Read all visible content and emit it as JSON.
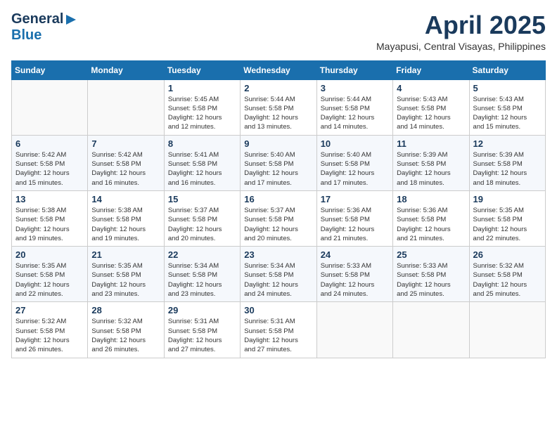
{
  "header": {
    "logo": {
      "general": "General",
      "blue": "Blue",
      "triangle": "▶"
    },
    "month": "April 2025",
    "location": "Mayapusi, Central Visayas, Philippines"
  },
  "weekdays": [
    "Sunday",
    "Monday",
    "Tuesday",
    "Wednesday",
    "Thursday",
    "Friday",
    "Saturday"
  ],
  "weeks": [
    [
      {
        "day": "",
        "info": ""
      },
      {
        "day": "",
        "info": ""
      },
      {
        "day": "1",
        "info": "Sunrise: 5:45 AM\nSunset: 5:58 PM\nDaylight: 12 hours\nand 12 minutes."
      },
      {
        "day": "2",
        "info": "Sunrise: 5:44 AM\nSunset: 5:58 PM\nDaylight: 12 hours\nand 13 minutes."
      },
      {
        "day": "3",
        "info": "Sunrise: 5:44 AM\nSunset: 5:58 PM\nDaylight: 12 hours\nand 14 minutes."
      },
      {
        "day": "4",
        "info": "Sunrise: 5:43 AM\nSunset: 5:58 PM\nDaylight: 12 hours\nand 14 minutes."
      },
      {
        "day": "5",
        "info": "Sunrise: 5:43 AM\nSunset: 5:58 PM\nDaylight: 12 hours\nand 15 minutes."
      }
    ],
    [
      {
        "day": "6",
        "info": "Sunrise: 5:42 AM\nSunset: 5:58 PM\nDaylight: 12 hours\nand 15 minutes."
      },
      {
        "day": "7",
        "info": "Sunrise: 5:42 AM\nSunset: 5:58 PM\nDaylight: 12 hours\nand 16 minutes."
      },
      {
        "day": "8",
        "info": "Sunrise: 5:41 AM\nSunset: 5:58 PM\nDaylight: 12 hours\nand 16 minutes."
      },
      {
        "day": "9",
        "info": "Sunrise: 5:40 AM\nSunset: 5:58 PM\nDaylight: 12 hours\nand 17 minutes."
      },
      {
        "day": "10",
        "info": "Sunrise: 5:40 AM\nSunset: 5:58 PM\nDaylight: 12 hours\nand 17 minutes."
      },
      {
        "day": "11",
        "info": "Sunrise: 5:39 AM\nSunset: 5:58 PM\nDaylight: 12 hours\nand 18 minutes."
      },
      {
        "day": "12",
        "info": "Sunrise: 5:39 AM\nSunset: 5:58 PM\nDaylight: 12 hours\nand 18 minutes."
      }
    ],
    [
      {
        "day": "13",
        "info": "Sunrise: 5:38 AM\nSunset: 5:58 PM\nDaylight: 12 hours\nand 19 minutes."
      },
      {
        "day": "14",
        "info": "Sunrise: 5:38 AM\nSunset: 5:58 PM\nDaylight: 12 hours\nand 19 minutes."
      },
      {
        "day": "15",
        "info": "Sunrise: 5:37 AM\nSunset: 5:58 PM\nDaylight: 12 hours\nand 20 minutes."
      },
      {
        "day": "16",
        "info": "Sunrise: 5:37 AM\nSunset: 5:58 PM\nDaylight: 12 hours\nand 20 minutes."
      },
      {
        "day": "17",
        "info": "Sunrise: 5:36 AM\nSunset: 5:58 PM\nDaylight: 12 hours\nand 21 minutes."
      },
      {
        "day": "18",
        "info": "Sunrise: 5:36 AM\nSunset: 5:58 PM\nDaylight: 12 hours\nand 21 minutes."
      },
      {
        "day": "19",
        "info": "Sunrise: 5:35 AM\nSunset: 5:58 PM\nDaylight: 12 hours\nand 22 minutes."
      }
    ],
    [
      {
        "day": "20",
        "info": "Sunrise: 5:35 AM\nSunset: 5:58 PM\nDaylight: 12 hours\nand 22 minutes."
      },
      {
        "day": "21",
        "info": "Sunrise: 5:35 AM\nSunset: 5:58 PM\nDaylight: 12 hours\nand 23 minutes."
      },
      {
        "day": "22",
        "info": "Sunrise: 5:34 AM\nSunset: 5:58 PM\nDaylight: 12 hours\nand 23 minutes."
      },
      {
        "day": "23",
        "info": "Sunrise: 5:34 AM\nSunset: 5:58 PM\nDaylight: 12 hours\nand 24 minutes."
      },
      {
        "day": "24",
        "info": "Sunrise: 5:33 AM\nSunset: 5:58 PM\nDaylight: 12 hours\nand 24 minutes."
      },
      {
        "day": "25",
        "info": "Sunrise: 5:33 AM\nSunset: 5:58 PM\nDaylight: 12 hours\nand 25 minutes."
      },
      {
        "day": "26",
        "info": "Sunrise: 5:32 AM\nSunset: 5:58 PM\nDaylight: 12 hours\nand 25 minutes."
      }
    ],
    [
      {
        "day": "27",
        "info": "Sunrise: 5:32 AM\nSunset: 5:58 PM\nDaylight: 12 hours\nand 26 minutes."
      },
      {
        "day": "28",
        "info": "Sunrise: 5:32 AM\nSunset: 5:58 PM\nDaylight: 12 hours\nand 26 minutes."
      },
      {
        "day": "29",
        "info": "Sunrise: 5:31 AM\nSunset: 5:58 PM\nDaylight: 12 hours\nand 27 minutes."
      },
      {
        "day": "30",
        "info": "Sunrise: 5:31 AM\nSunset: 5:58 PM\nDaylight: 12 hours\nand 27 minutes."
      },
      {
        "day": "",
        "info": ""
      },
      {
        "day": "",
        "info": ""
      },
      {
        "day": "",
        "info": ""
      }
    ]
  ]
}
